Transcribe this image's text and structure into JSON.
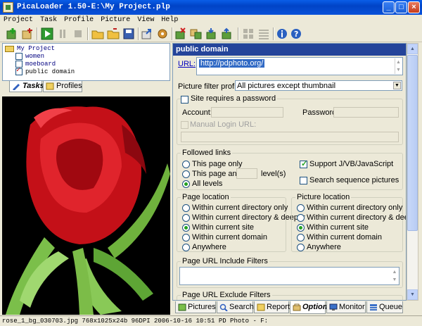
{
  "window": {
    "title": "PicaLoader 1.50-E:\\My Project.plp"
  },
  "menu": [
    "Project",
    "Task",
    "Profile",
    "Picture",
    "View",
    "Help"
  ],
  "tree": {
    "root": "My Project",
    "items": [
      {
        "label": "women",
        "checked": false
      },
      {
        "label": "moeboard",
        "checked": false
      },
      {
        "label": "public domain",
        "checked": true
      }
    ]
  },
  "left_tabs": {
    "tasks": "Tasks",
    "profiles": "Profiles"
  },
  "status": "rose_1_bg_030703.jpg 768x1025x24b 96DPI 2006-10-16 10:51 PD Photo - F:",
  "panel": {
    "header": "public domain",
    "url_label": "URL:",
    "url_value": "http://pdphoto.org/",
    "filter_label": "Picture filter profile:",
    "filter_value": "All pictures except thumbnail",
    "password_check": "Site requires a password",
    "account_label": "Account:",
    "password_label": "Password:",
    "manual_login": "Manual Login URL:",
    "followed_links": "Followed links",
    "this_page_only": "This page only",
    "this_page_and": "This page and",
    "levels": "level(s)",
    "all_levels": "All levels",
    "support_js": "Support J/VB/JavaScript",
    "search_seq": "Search sequence pictures",
    "page_location": "Page location",
    "picture_location": "Picture location",
    "loc_options": [
      "Within current directory only",
      "Within current directory & deeper",
      "Within current site",
      "Within current domain",
      "Anywhere"
    ],
    "include_filters": "Page URL Include Filters",
    "exclude_filters": "Page URL Exclude Filters"
  },
  "bottom_tabs": [
    "Pictures",
    "Search",
    "Report",
    "Option",
    "Monitor",
    "Queue"
  ]
}
